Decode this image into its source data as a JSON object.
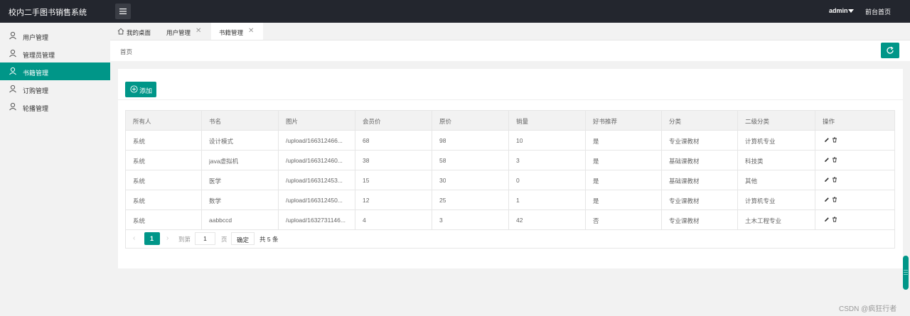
{
  "header": {
    "title": "校内二手图书销售系统",
    "user": "admin",
    "front_link": "前台首页"
  },
  "sidebar": {
    "items": [
      {
        "label": "用户管理"
      },
      {
        "label": "管理员管理"
      },
      {
        "label": "书籍管理",
        "active": true
      },
      {
        "label": "订购管理"
      },
      {
        "label": "轮播管理"
      }
    ]
  },
  "tabs": [
    {
      "label": "我的桌面"
    },
    {
      "label": "用户管理"
    },
    {
      "label": "书籍管理",
      "active": true
    }
  ],
  "breadcrumb": "首页",
  "toolbar": {
    "add_label": "添加"
  },
  "table": {
    "columns": [
      "所有人",
      "书名",
      "图片",
      "会员价",
      "原价",
      "销量",
      "好书推荐",
      "分类",
      "二级分类",
      "操作"
    ],
    "rows": [
      [
        "系统",
        "设计模式",
        "/upload/166312466...",
        "68",
        "98",
        "10",
        "是",
        "专业课教材",
        "计算机专业"
      ],
      [
        "系统",
        "java虚拟机",
        "/upload/166312460...",
        "38",
        "58",
        "3",
        "是",
        "基础课教材",
        "科技类"
      ],
      [
        "系统",
        "医学",
        "/upload/166312453...",
        "15",
        "30",
        "0",
        "是",
        "基础课教材",
        "其他"
      ],
      [
        "系统",
        "数学",
        "/upload/166312450...",
        "12",
        "25",
        "1",
        "是",
        "专业课教材",
        "计算机专业"
      ],
      [
        "系统",
        "aabbccd",
        "/upload/1632731146...",
        "4",
        "3",
        "42",
        "否",
        "专业课教材",
        "土木工程专业"
      ]
    ]
  },
  "pager": {
    "current": "1",
    "goto_label": "到第",
    "goto_value": "1",
    "page_label": "页",
    "confirm_label": "确定",
    "total": "共 5 条"
  },
  "watermark": "CSDN @疯狂行者",
  "colors": {
    "accent": "#009688",
    "header_bg": "#23262e"
  }
}
